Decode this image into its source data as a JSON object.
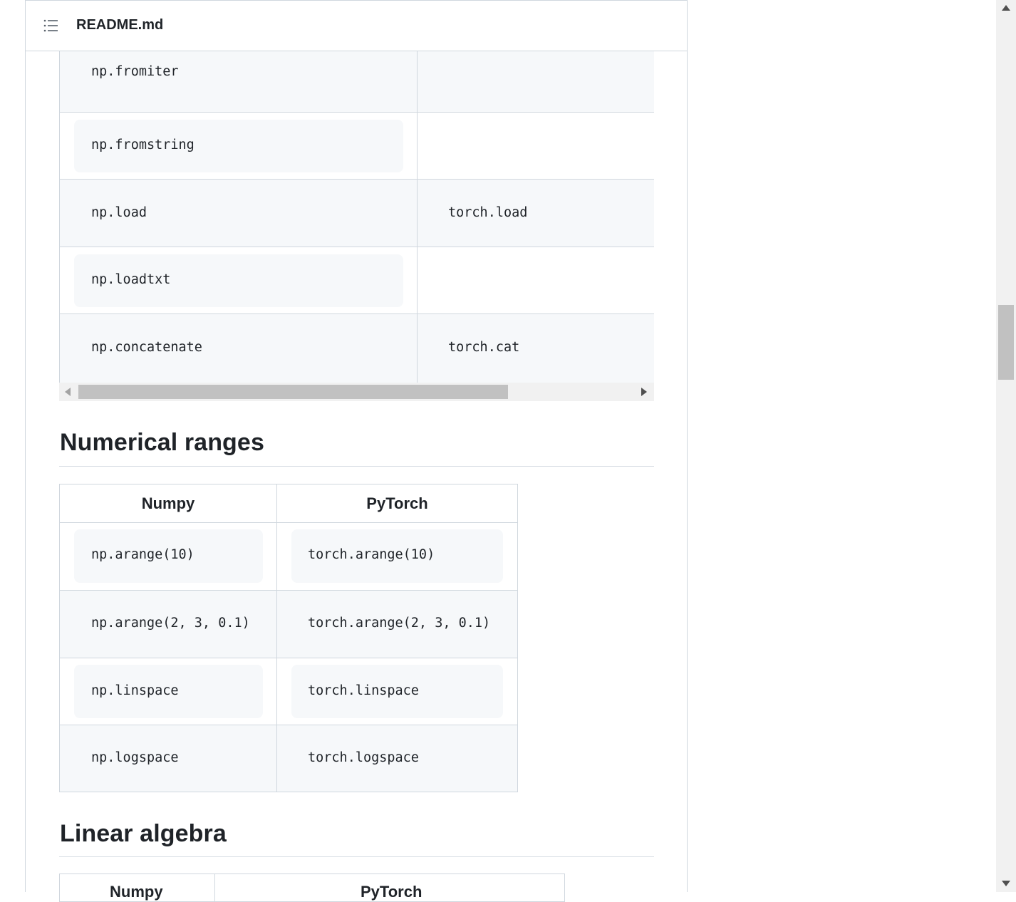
{
  "header": {
    "title": "README.md",
    "toc_icon": "list-unordered-icon"
  },
  "top_table": {
    "rows": [
      {
        "numpy": "np.fromiter",
        "pytorch": ""
      },
      {
        "numpy": "np.fromstring",
        "pytorch": ""
      },
      {
        "numpy": "np.load",
        "pytorch": "torch.load"
      },
      {
        "numpy": "np.loadtxt",
        "pytorch": ""
      },
      {
        "numpy": "np.concatenate",
        "pytorch": "torch.cat"
      }
    ]
  },
  "sections": {
    "numerical_ranges": {
      "heading": "Numerical ranges",
      "columns": [
        "Numpy",
        "PyTorch"
      ],
      "rows": [
        {
          "numpy": "np.arange(10)",
          "pytorch": "torch.arange(10)"
        },
        {
          "numpy": "np.arange(2, 3, 0.1)",
          "pytorch": "torch.arange(2, 3, 0.1)"
        },
        {
          "numpy": "np.linspace",
          "pytorch": "torch.linspace"
        },
        {
          "numpy": "np.logspace",
          "pytorch": "torch.logspace"
        }
      ]
    },
    "linear_algebra": {
      "heading": "Linear algebra",
      "columns": [
        "Numpy",
        "PyTorch"
      ]
    }
  },
  "colors": {
    "border": "#d0d7de",
    "code_bg": "#f6f8fa",
    "text": "#1f2328"
  }
}
